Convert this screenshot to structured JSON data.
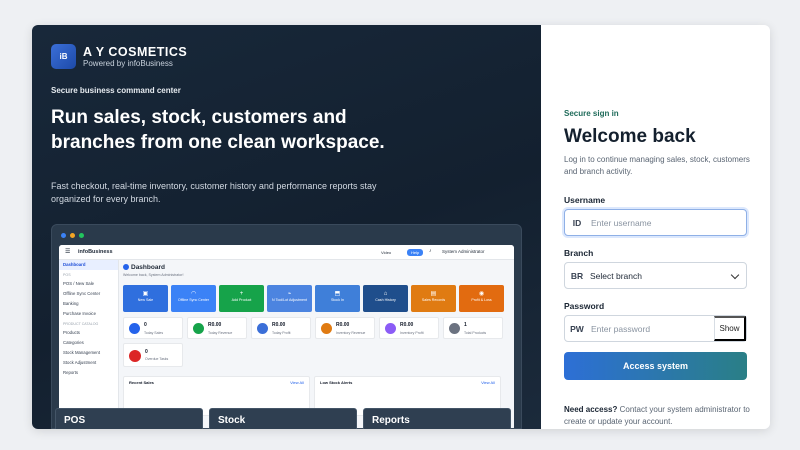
{
  "brand": {
    "logo": "iB",
    "name": "A Y COSMETICS",
    "tagline": "Powered by infoBusiness"
  },
  "hero": {
    "eyebrow": "Secure business command center",
    "headline": "Run sales, stock, customers and branches from one clean workspace.",
    "lead": "Fast checkout, real-time inventory, customer history and performance reports stay organized for every branch."
  },
  "preview": {
    "app_name": "infoBusiness",
    "top_video": "Video",
    "top_help": "Help",
    "top_user": "System Administrator",
    "sidebar": [
      {
        "label": "Dashboard",
        "type": "active"
      },
      {
        "label": "POS",
        "type": "head"
      },
      {
        "label": "POS / New Sale",
        "type": "item"
      },
      {
        "label": "Offline Sync Center",
        "type": "item"
      },
      {
        "label": "Banking",
        "type": "item"
      },
      {
        "label": "Purchase Invoice",
        "type": "item"
      },
      {
        "label": "PRODUCT CATALOG",
        "type": "head"
      },
      {
        "label": "Products",
        "type": "item"
      },
      {
        "label": "Categories",
        "type": "item"
      },
      {
        "label": "Stock Management",
        "type": "item"
      },
      {
        "label": "Stock Adjustment",
        "type": "item"
      },
      {
        "label": "Reports",
        "type": "item"
      }
    ],
    "dashboard_title": "Dashboard",
    "dashboard_sub": "Welcome back, System Administrator!",
    "tiles": [
      {
        "label": "New Sale",
        "icon": "cart-icon",
        "glyph": "▣",
        "color": "#2f6fde"
      },
      {
        "label": "Offline Sync Center",
        "icon": "wifi-icon",
        "glyph": "◠",
        "color": "#3b82f6"
      },
      {
        "label": "Add Product",
        "icon": "plus-icon",
        "glyph": "+",
        "color": "#16a34a"
      },
      {
        "label": "N Tool/Lot Adjustment",
        "icon": "chart-icon",
        "glyph": "⌁",
        "color": "#4c84e0"
      },
      {
        "label": "Stock In",
        "icon": "box-icon",
        "glyph": "⬒",
        "color": "#3f7fd9"
      },
      {
        "label": "Cash History",
        "icon": "bank-icon",
        "glyph": "⌂",
        "color": "#1f4e8c"
      },
      {
        "label": "Sales Records",
        "icon": "chart-icon",
        "glyph": "▤",
        "color": "#e07b12"
      },
      {
        "label": "Profit & Loss",
        "icon": "coins-icon",
        "glyph": "◉",
        "color": "#e26b10"
      }
    ],
    "stats": [
      {
        "value": "0",
        "label": "Today Sales",
        "color": "#2563eb"
      },
      {
        "value": "R0.00",
        "label": "Today Revenue",
        "color": "#16a34a"
      },
      {
        "value": "R0.00",
        "label": "Today Profit",
        "color": "#3b6fd8"
      },
      {
        "value": "R0.00",
        "label": "Inventory Revenue",
        "color": "#e07b12"
      },
      {
        "value": "R0.00",
        "label": "Inventory Profit",
        "color": "#8b5cf6"
      },
      {
        "value": "1",
        "label": "Total Products",
        "color": "#6b7280"
      }
    ],
    "stat_extra": {
      "value": "0",
      "label": "Overdue Tasks"
    },
    "panels": [
      {
        "title": "Recent Sales",
        "link": "View All"
      },
      {
        "title": "Low Stock Alerts",
        "link": "View All"
      }
    ]
  },
  "features": [
    "POS",
    "Stock",
    "Reports"
  ],
  "auth": {
    "eyebrow": "Secure sign in",
    "title": "Welcome back",
    "desc": "Log in to continue managing sales, stock, customers and branch activity.",
    "username": {
      "label": "Username",
      "prefix": "ID",
      "placeholder": "Enter username",
      "value": ""
    },
    "branch": {
      "label": "Branch",
      "prefix": "BR",
      "selected": "Select branch"
    },
    "password": {
      "label": "Password",
      "prefix": "PW",
      "placeholder": "Enter password",
      "value": "",
      "toggle": "Show"
    },
    "submit": "Access system",
    "access_title": "Need access?",
    "access_text": "Contact your system administrator to create or update your account."
  }
}
